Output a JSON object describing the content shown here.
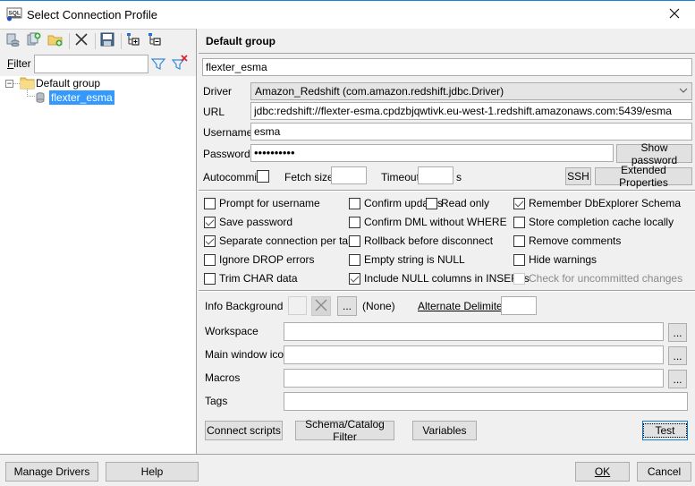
{
  "window": {
    "title": "Select Connection Profile",
    "icon": "sql-icon",
    "close_icon": "close-icon"
  },
  "left_panel": {
    "toolbar": [
      {
        "name": "new-profile-icon",
        "tooltip": "New profile"
      },
      {
        "name": "copy-profile-icon",
        "tooltip": "Copy profile"
      },
      {
        "name": "new-group-icon",
        "tooltip": "New group"
      },
      {
        "name": "delete-icon",
        "tooltip": "Delete"
      },
      {
        "name": "save-icon",
        "tooltip": "Save"
      },
      {
        "name": "expand-all-icon",
        "tooltip": "Expand all"
      },
      {
        "name": "collapse-all-icon",
        "tooltip": "Collapse all"
      }
    ],
    "filter": {
      "label": "Filter",
      "mnemonic": "F",
      "label_rest": "ilter",
      "value": ""
    },
    "tree": {
      "group": {
        "label": "Default group",
        "expanded": true
      },
      "profiles": [
        {
          "label": "flexter_esma",
          "selected": true
        }
      ]
    }
  },
  "profile": {
    "group_title": "Default group",
    "name": "flexter_esma",
    "driver_label": "Driver",
    "driver_value": "Amazon_Redshift (com.amazon.redshift.jdbc.Driver)",
    "url_label": "URL",
    "url_value": "jdbc:redshift://flexter-esma.cpdzbjqwtivk.eu-west-1.redshift.amazonaws.com:5439/esma",
    "username_label": "Username",
    "username_value": "esma",
    "password_label": "Password",
    "password_value": "••••••••••",
    "show_password_label": "Show password",
    "autocommit_label": "Autocommit",
    "autocommit_checked": false,
    "fetch_size_label": "Fetch size",
    "fetch_size_value": "",
    "timeout_label": "Timeout",
    "timeout_value": "",
    "timeout_unit": "s",
    "ssh_label": "SSH",
    "extended_properties_label": "Extended Properties"
  },
  "options": {
    "col1": [
      {
        "label": "Prompt for username",
        "checked": false
      },
      {
        "label": "Save password",
        "checked": true
      },
      {
        "label": "Separate connection per tab",
        "checked": true
      },
      {
        "label": "Ignore DROP errors",
        "checked": false
      },
      {
        "label": "Trim CHAR data",
        "checked": false
      }
    ],
    "col2": [
      {
        "label": "Confirm updates",
        "checked": false
      },
      {
        "label": "Confirm DML without WHERE",
        "checked": false
      },
      {
        "label": "Rollback before disconnect",
        "checked": false
      },
      {
        "label": "Empty string is NULL",
        "checked": false
      },
      {
        "label": "Include NULL columns in INSERTs",
        "checked": true
      }
    ],
    "read_only": {
      "label": "Read only",
      "checked": false
    },
    "col3": [
      {
        "label": "Remember DbExplorer Schema",
        "checked": true,
        "disabled": false
      },
      {
        "label": "Store completion cache locally",
        "checked": false,
        "disabled": false
      },
      {
        "label": "Remove comments",
        "checked": false,
        "disabled": false
      },
      {
        "label": "Hide warnings",
        "checked": false,
        "disabled": false
      },
      {
        "label": "Check for uncommitted changes",
        "checked": false,
        "disabled": true
      }
    ]
  },
  "extras": {
    "info_background_label": "Info Background",
    "info_background_value": "(None)",
    "ellipsis": "...",
    "alternate_delimiter_label": "Alternate Delimiter",
    "alternate_delimiter_value": "",
    "workspace_label": "Workspace",
    "workspace_value": "",
    "main_window_icon_label": "Main window icon",
    "main_window_icon_value": "",
    "macros_label": "Macros",
    "macros_value": "",
    "tags_label": "Tags",
    "tags_value": "",
    "connect_scripts_label": "Connect scripts",
    "schema_filter_label": "Schema/Catalog Filter",
    "variables_label": "Variables",
    "test_label": "Test"
  },
  "footer": {
    "manage_drivers_label": "Manage Drivers",
    "help_label": "Help",
    "ok_label": "OK",
    "cancel_label": "Cancel"
  }
}
